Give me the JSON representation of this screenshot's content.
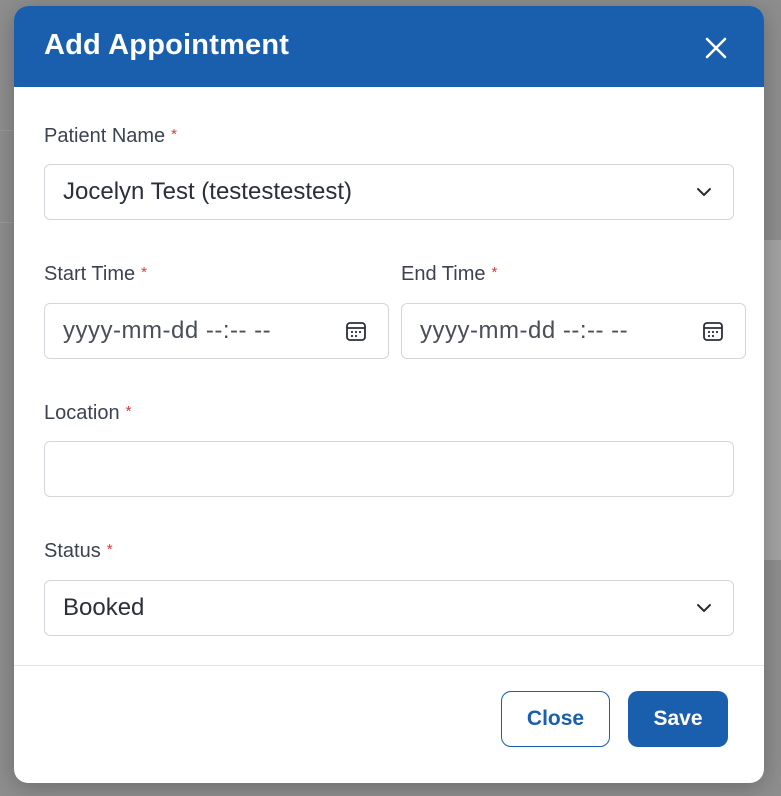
{
  "modal": {
    "title": "Add Appointment",
    "required_mark": "*"
  },
  "fields": {
    "patient": {
      "label": "Patient Name",
      "value": "Jocelyn Test (testestestest)"
    },
    "start_time": {
      "label": "Start Time",
      "placeholder": "yyyy-mm-dd --:-- --"
    },
    "end_time": {
      "label": "End Time",
      "placeholder": "yyyy-mm-dd --:-- --"
    },
    "location": {
      "label": "Location",
      "value": ""
    },
    "status": {
      "label": "Status",
      "value": "Booked"
    }
  },
  "footer": {
    "close_label": "Close",
    "save_label": "Save"
  },
  "colors": {
    "primary": "#1a5fad",
    "required": "#d43d3d"
  }
}
